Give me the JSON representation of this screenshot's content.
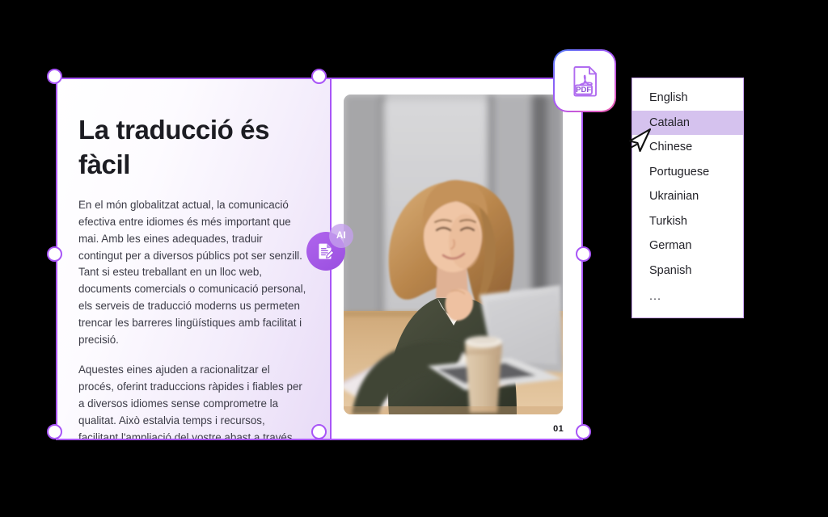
{
  "document": {
    "title": "La traducció és fàcil",
    "paragraphs": [
      "En el món globalitzat actual, la comunicació efectiva entre idiomes és més important que mai. Amb les eines adequades, traduir contingut per a diversos públics pot ser senzill. Tant si esteu treballant en un lloc web, documents comercials o comunicació personal, els serveis de traducció moderns us permeten trencar les barreres lingüístiques amb facilitat i precisió.",
      "Aquestes eines ajuden a racionalitzar el procés, oferint traduccions ràpides i fiables per a diversos idiomes sense comprometre la qualitat. Això estalvia temps i recursos, facilitant l'ampliació del vostre abast a través de les fronteres."
    ],
    "page_number": "01"
  },
  "photo": {
    "alt": "Smiling woman with curly blonde hair in olive sweater working at a laptop with a coffee cup on a wooden desk"
  },
  "ai_badge": {
    "label": "AI",
    "icon": "document-edit-icon"
  },
  "pdf_badge": {
    "label": "PDF",
    "icon": "pdf-file-icon"
  },
  "language_dropdown": {
    "selected": "Catalan",
    "items": [
      "English",
      "Catalan",
      "Chinese",
      "Portuguese",
      "Ukrainian",
      "Turkish",
      "German",
      "Spanish",
      "..."
    ]
  },
  "colors": {
    "accent": "#a855f7",
    "selection_highlight": "#d5c2ee",
    "dropdown_border": "#c8a2f0",
    "page_gradient_start": "#ffffff",
    "page_gradient_end": "#e8dbf7",
    "canvas_background": "#000000"
  }
}
